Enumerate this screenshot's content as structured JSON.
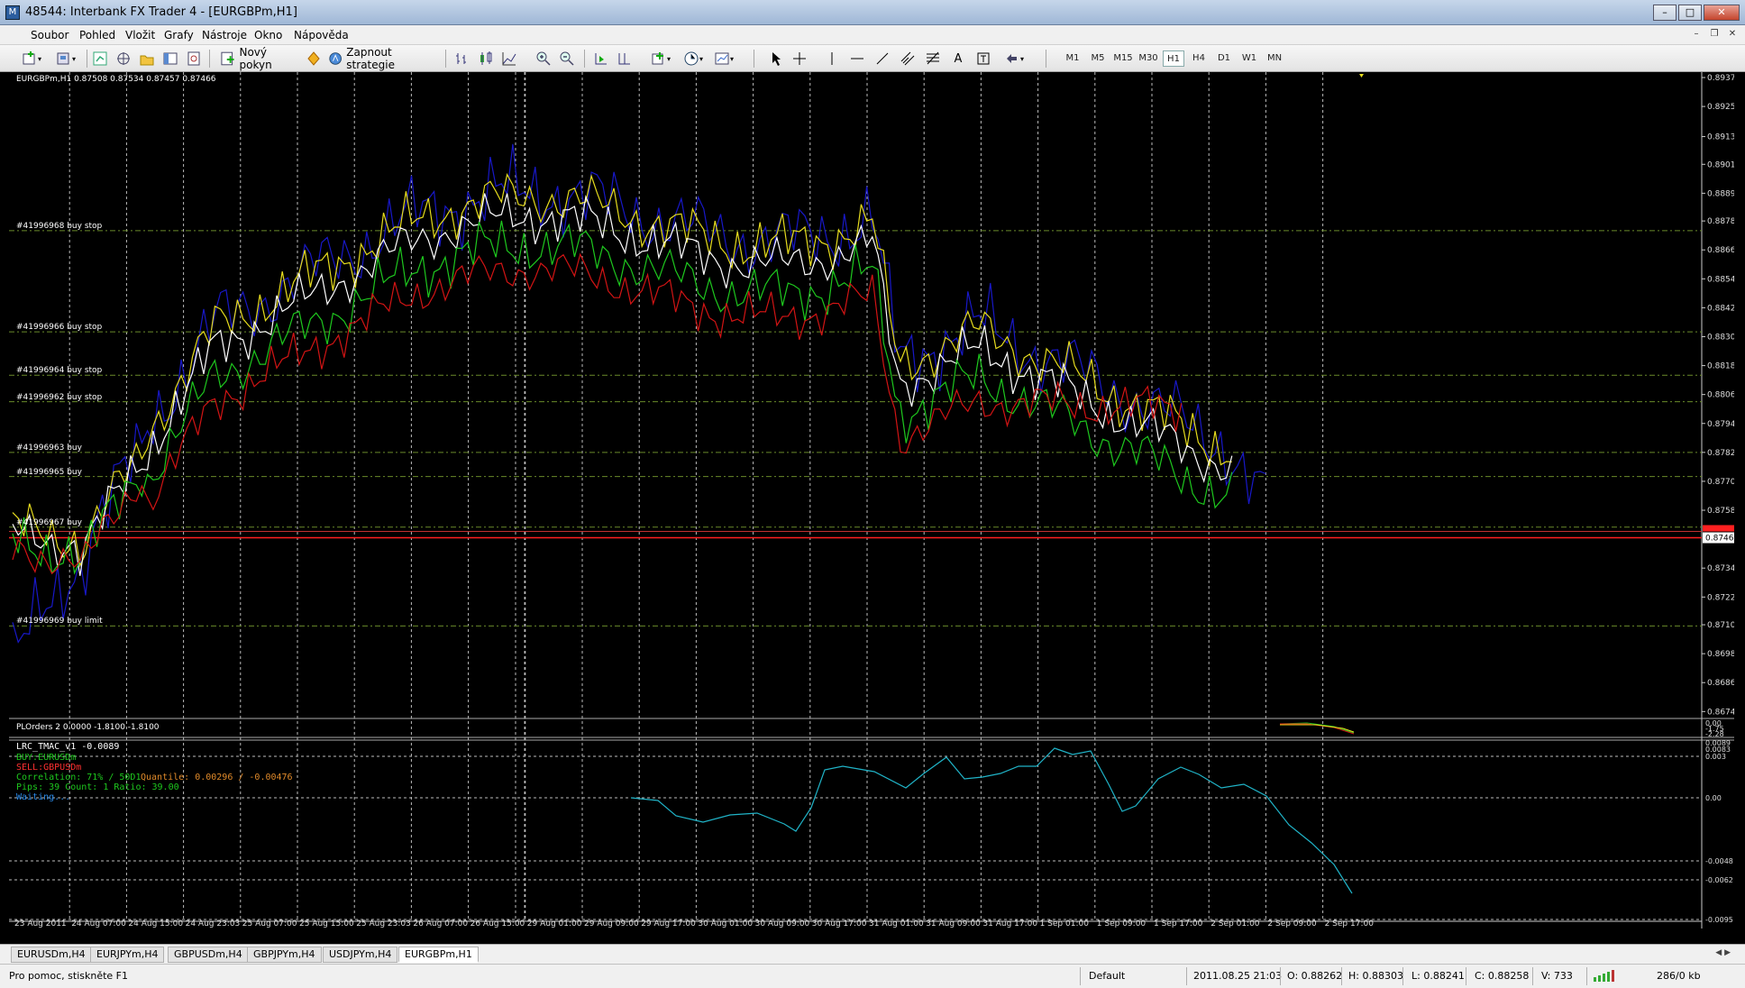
{
  "window": {
    "title": "48544: Interbank FX Trader 4 - [EURGBPm,H1]",
    "app_icon": "mt4-icon"
  },
  "menu": {
    "items": [
      "Soubor",
      "Pohled",
      "Vložit",
      "Grafy",
      "Nástroje",
      "Okno",
      "Nápověda"
    ]
  },
  "toolbar": {
    "new_order_label": "Nový pokyn",
    "strategy_label": "Zapnout strategie",
    "timeframes": [
      "M1",
      "M5",
      "M15",
      "M30",
      "H1",
      "H4",
      "D1",
      "W1",
      "MN"
    ],
    "active_timeframe": "H1"
  },
  "chart": {
    "symbol_info": "EURGBPm,H1  0.87508 0.87534 0.87457 0.87466",
    "current_price": "0.87466",
    "price_ticks": [
      "0.89375",
      "0.89255",
      "0.89130",
      "0.89015",
      "0.88895",
      "0.88780",
      "0.88660",
      "0.88540",
      "0.88420",
      "0.88300",
      "0.88180",
      "0.88060",
      "0.87940",
      "0.87820",
      "0.87700",
      "0.87580",
      "0.87466",
      "0.87340",
      "0.87220",
      "0.87105",
      "0.86985",
      "0.86865",
      "0.86745"
    ],
    "time_ticks": [
      "23 Aug 2011",
      "24 Aug 07:00",
      "24 Aug 15:00",
      "24 Aug 23:03",
      "25 Aug 07:00",
      "25 Aug 15:00",
      "25 Aug 23:03",
      "26 Aug 07:00",
      "26 Aug 15:00",
      "29 Aug 01:00",
      "29 Aug 09:00",
      "29 Aug 17:00",
      "30 Aug 01:00",
      "30 Aug 09:00",
      "30 Aug 17:00",
      "31 Aug 01:00",
      "31 Aug 09:00",
      "31 Aug 17:00",
      "1 Sep 01:00",
      "1 Sep 09:00",
      "1 Sep 17:00",
      "2 Sep 01:00",
      "2 Sep 09:00",
      "2 Sep 17:00"
    ],
    "orders": [
      {
        "label": "#41996968 buy stop",
        "price": 0.8874
      },
      {
        "label": "#41996966 buy stop",
        "price": 0.8832
      },
      {
        "label": "#41996964 buy stop",
        "price": 0.8814
      },
      {
        "label": "#41996962 buy stop",
        "price": 0.8803
      },
      {
        "label": "#41996963 buy",
        "price": 0.8782
      },
      {
        "label": "#41996965 buy",
        "price": 0.8772
      },
      {
        "label": "#41996967 buy",
        "price": 0.8751
      },
      {
        "label": "#41996969 buy limit",
        "price": 0.871
      }
    ],
    "colors": {
      "blue": "#1818c8",
      "yellow": "#e6dc1e",
      "white": "#ffffff",
      "red": "#d21414",
      "green": "#1ec81e",
      "cyan": "#20b4c8",
      "order_line": "#6a8a2a",
      "bid_line": "#ff2020"
    }
  },
  "indicator1": {
    "label": "PLOrders 2 0.0000 -1.8100 -1.8100",
    "ticks": [
      "0.00",
      "-1.75",
      "-2.28"
    ]
  },
  "indicator2": {
    "label": "LRC_TMAC_v1 -0.0089",
    "buy_text": "BUY:EURUSDm",
    "sell_text": "SELL:GBPUSDm",
    "correlation_text": "Correlation: 71% / 50D1",
    "quantile_text": "Quantile: 0.00296 / -0.00476",
    "pips_text": "Pips: 39 Count: 1 Ratio: 39.00",
    "waiting_text": "Waiting...",
    "ticks": [
      "0.0089",
      "0.0083",
      "0.003",
      "0.00",
      "-0.0048",
      "-0.0062",
      "-0.0095"
    ]
  },
  "tabs": {
    "items": [
      "EURUSDm,H4",
      "EURJPYm,H4",
      "GBPUSDm,H4",
      "GBPJPYm,H4",
      "USDJPYm,H4",
      "EURGBPm,H1"
    ],
    "active": 5
  },
  "status": {
    "help": "Pro pomoc, stiskněte F1",
    "profile": "Default",
    "datetime": "2011.08.25 21:03",
    "open": "O: 0.88262",
    "high": "H: 0.88303",
    "low": "L: 0.88241",
    "close": "C: 0.88258",
    "volume": "V: 733",
    "traffic": "286/0 kb"
  }
}
